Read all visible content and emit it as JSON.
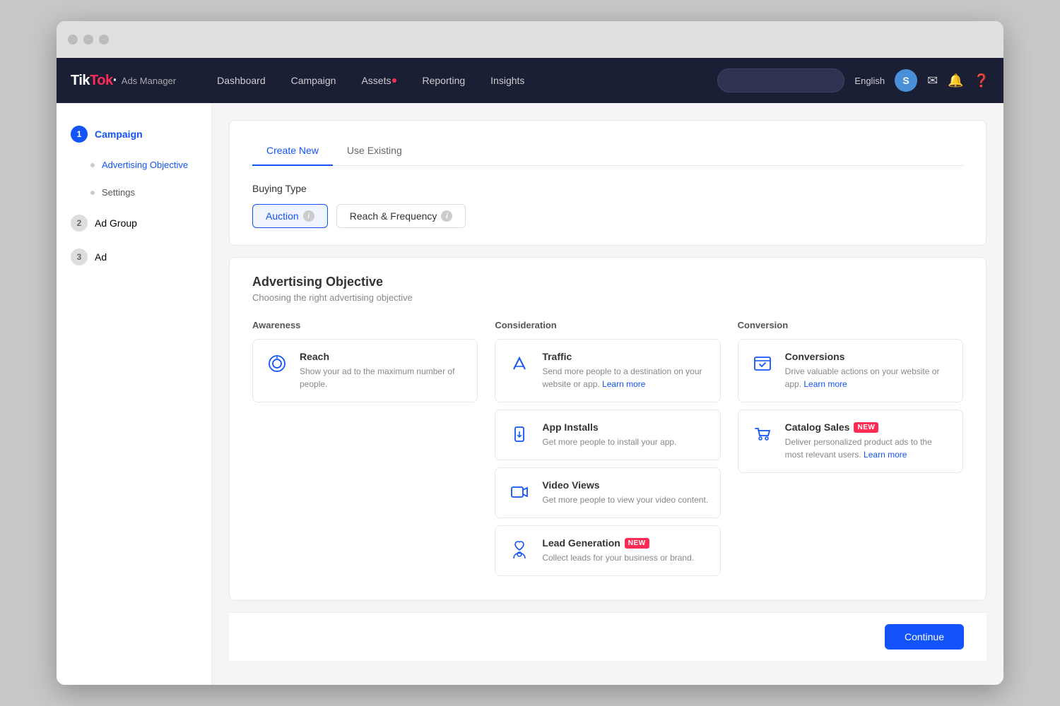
{
  "browser": {
    "dots": [
      "dot1",
      "dot2",
      "dot3"
    ]
  },
  "topnav": {
    "logo_main": "TikTok",
    "logo_dot": "·",
    "logo_sub": "Ads Manager",
    "links": [
      {
        "label": "Dashboard",
        "name": "dashboard"
      },
      {
        "label": "Campaign",
        "name": "campaign"
      },
      {
        "label": "Assets",
        "name": "assets",
        "has_dot": true
      },
      {
        "label": "Reporting",
        "name": "reporting"
      },
      {
        "label": "Insights",
        "name": "insights"
      }
    ],
    "lang": "English",
    "avatar_letter": "S",
    "search_placeholder": ""
  },
  "sidebar": {
    "items": [
      {
        "step": "1",
        "label": "Campaign",
        "active": true
      },
      {
        "step": null,
        "label": "Advertising Objective",
        "sub": true,
        "active": true
      },
      {
        "step": null,
        "label": "Settings",
        "sub": true,
        "active": false
      },
      {
        "step": "2",
        "label": "Ad Group",
        "active": false
      },
      {
        "step": "3",
        "label": "Ad",
        "active": false
      }
    ]
  },
  "tabs": [
    {
      "label": "Create New",
      "active": true
    },
    {
      "label": "Use Existing",
      "active": false
    }
  ],
  "buying_type": {
    "label": "Buying Type",
    "options": [
      {
        "label": "Auction",
        "selected": true
      },
      {
        "label": "Reach & Frequency",
        "selected": false
      }
    ]
  },
  "advertising_objective": {
    "title": "Advertising Objective",
    "subtitle": "Choosing the right advertising objective",
    "columns": [
      {
        "header": "Awareness",
        "cards": [
          {
            "title": "Reach",
            "desc": "Show your ad to the maximum number of people.",
            "icon": "reach-icon",
            "is_new": false
          }
        ]
      },
      {
        "header": "Consideration",
        "cards": [
          {
            "title": "Traffic",
            "desc": "Send more people to a destination on your website or app.",
            "link_text": "Learn more",
            "icon": "traffic-icon",
            "is_new": false
          },
          {
            "title": "App Installs",
            "desc": "Get more people to install your app.",
            "icon": "app-installs-icon",
            "is_new": false
          },
          {
            "title": "Video Views",
            "desc": "Get more people to view your video content.",
            "icon": "video-views-icon",
            "is_new": false
          },
          {
            "title": "Lead Generation",
            "desc": "Collect leads for your business or brand.",
            "icon": "lead-gen-icon",
            "is_new": true
          }
        ]
      },
      {
        "header": "Conversion",
        "cards": [
          {
            "title": "Conversions",
            "desc": "Drive valuable actions on your website or app.",
            "link_text": "Learn more",
            "icon": "conversions-icon",
            "is_new": false
          },
          {
            "title": "Catalog Sales",
            "desc": "Deliver personalized product ads to the most relevant users.",
            "link_text": "Learn more",
            "icon": "catalog-sales-icon",
            "is_new": true
          }
        ]
      }
    ]
  },
  "footer": {
    "continue_label": "Continue"
  }
}
